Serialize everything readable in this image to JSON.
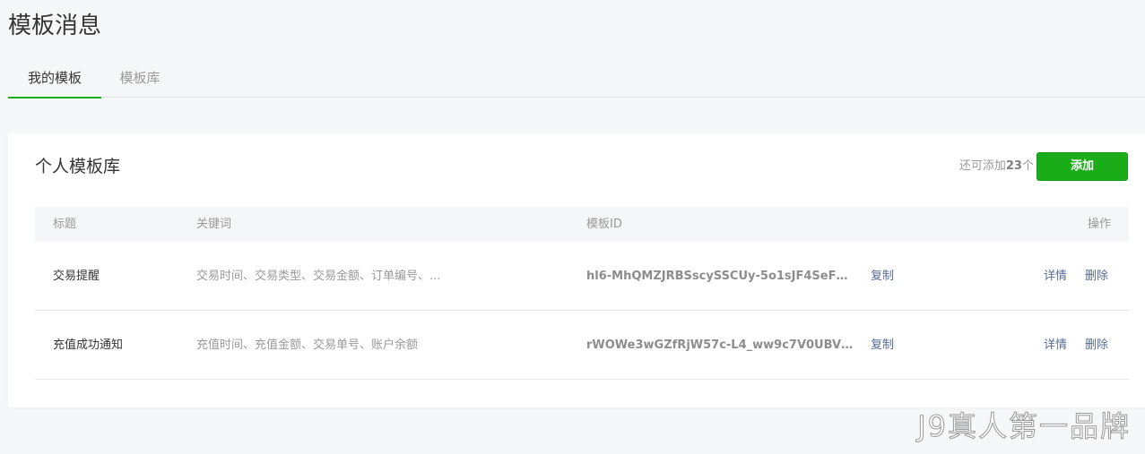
{
  "page": {
    "title": "模板消息"
  },
  "tabs": [
    {
      "label": "我的模板",
      "active": true
    },
    {
      "label": "模板库",
      "active": false
    }
  ],
  "card": {
    "title": "个人模板库",
    "quota_prefix": "还可添加",
    "quota_count": "23",
    "quota_suffix": "个",
    "add_label": "添加"
  },
  "table": {
    "headers": {
      "title": "标题",
      "keywords": "关键词",
      "template_id": "模板ID",
      "operations": "操作"
    },
    "rows": [
      {
        "title": "交易提醒",
        "keywords": "交易时间、交易类型、交易金额、订单编号、...",
        "template_id": "hl6-MhQMZJRBSscySSCUy-5o1sJF4SeF3...",
        "copy": "复制",
        "detail": "详情",
        "delete": "删除"
      },
      {
        "title": "充值成功通知",
        "keywords": "充值时间、充值金额、交易单号、账户余额",
        "template_id": "rWOWe3wGZfRjW57c-L4_ww9c7V0UBVg7...",
        "copy": "复制",
        "detail": "详情",
        "delete": "删除"
      }
    ]
  },
  "watermark": "J9真人第一品牌",
  "colors": {
    "accent": "#1aad19",
    "link": "#576b95",
    "muted": "#9a9a9a"
  }
}
